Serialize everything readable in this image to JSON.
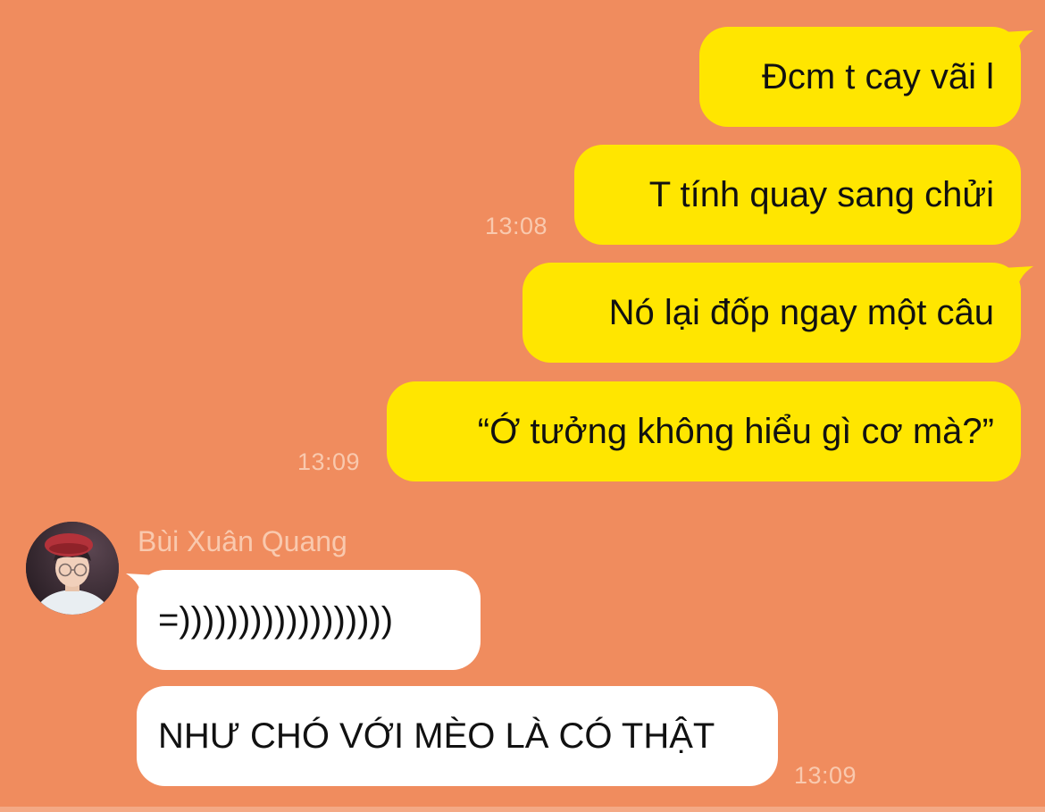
{
  "theme": {
    "background": "#F08C5E",
    "outgoing_bubble": "#FFE600",
    "incoming_bubble": "#FFFFFF",
    "timestamp_color": "#F9C9AE"
  },
  "outgoing": [
    {
      "text": "Đcm t cay vãi l"
    },
    {
      "text": "T tính quay sang chửi",
      "time": "13:08"
    },
    {
      "text": "Nó lại đốp ngay một câu"
    },
    {
      "text": "“Ớ tưởng không hiểu gì cơ mà?”",
      "time": "13:09"
    }
  ],
  "incoming": {
    "sender_name": "Bùi Xuân Quang",
    "avatar_icon": "user-avatar-icon",
    "messages": [
      {
        "text": "=))))))))))))))))))"
      },
      {
        "text": "NHƯ CHÓ VỚI MÈO LÀ CÓ THẬT",
        "time": "13:09"
      }
    ]
  }
}
